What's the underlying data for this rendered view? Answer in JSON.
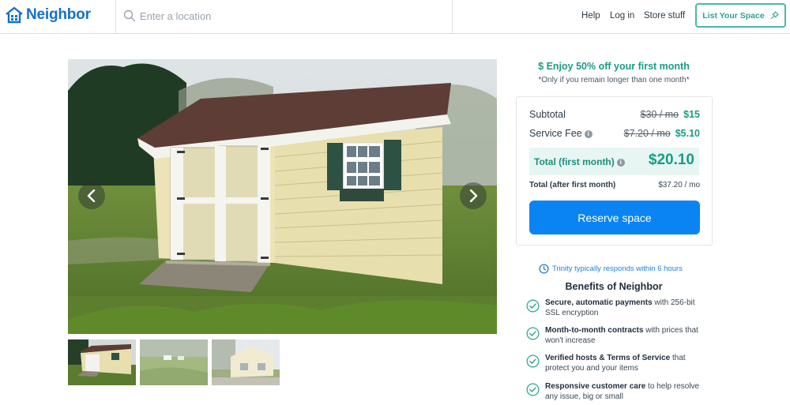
{
  "header": {
    "logo_text": "Neighbor",
    "search_placeholder": "Enter a location",
    "nav": {
      "help": "Help",
      "login": "Log in",
      "store": "Store stuff"
    },
    "list_button": "List Your Space"
  },
  "gallery": {
    "main_photo": "storage-shed-photo",
    "thumbnails": [
      "shed-front-thumbnail",
      "yard-view-thumbnail",
      "garage-view-thumbnail"
    ]
  },
  "promo": {
    "title": "$ Enjoy 50% off your first month",
    "subtitle": "*Only if you remain longer than one month*"
  },
  "pricing": {
    "subtotal_label": "Subtotal",
    "subtotal_original": "$30 / mo",
    "subtotal_value": "$15",
    "fee_label": "Service Fee",
    "fee_original": "$7.20 / mo",
    "fee_value": "$5.10",
    "total_label": "Total (first month)",
    "total_value": "$20.10",
    "after_label": "Total (after first month)",
    "after_value": "$37.20 / mo",
    "reserve_button": "Reserve space"
  },
  "host": {
    "response_text": "Trinity typically responds within 6 hours"
  },
  "benefits": {
    "title": "Benefits of Neighbor",
    "items": [
      {
        "bold": "Secure, automatic payments",
        "rest": " with 256-bit SSL encryption"
      },
      {
        "bold": "Month-to-month contracts",
        "rest": " with prices that won't increase"
      },
      {
        "bold": "Verified hosts & Terms of Service",
        "rest": " that protect you and your items"
      },
      {
        "bold": "Responsive customer care",
        "rest": " to help resolve any issue, big or small"
      }
    ]
  },
  "colors": {
    "brand_blue": "#1570c9",
    "accent_green": "#1b9c84",
    "button_blue": "#0b84f3"
  }
}
